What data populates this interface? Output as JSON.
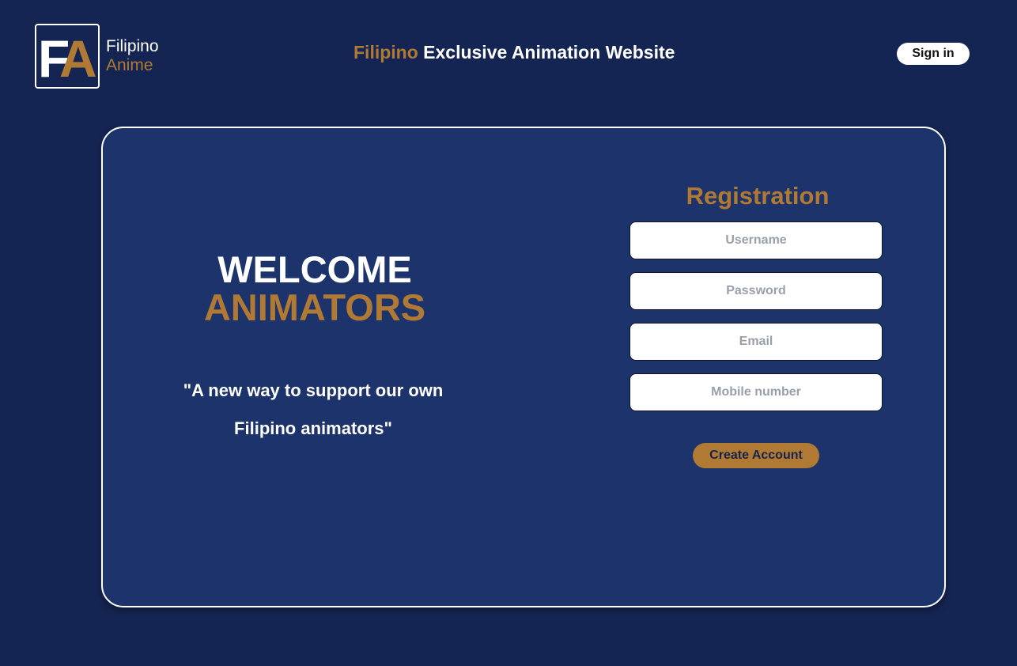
{
  "logo": {
    "letter_f": "F",
    "letter_a": "A",
    "line1": "Filipino",
    "line2": "Anime"
  },
  "header": {
    "title_accent": "Filipino",
    "title_rest": "Exclusive Animation Website",
    "signin_label": "Sign in"
  },
  "welcome": {
    "line1": "WELCOME",
    "line2": "ANIMATORS",
    "tagline": "\"A new way to support our own Filipino animators\""
  },
  "registration": {
    "title": "Registration",
    "fields": [
      {
        "placeholder": "Username",
        "value": ""
      },
      {
        "placeholder": "Password",
        "value": ""
      },
      {
        "placeholder": "Email",
        "value": ""
      },
      {
        "placeholder": "Mobile number",
        "value": ""
      }
    ],
    "submit_label": "Create Account"
  },
  "colors": {
    "background": "#152553",
    "card": "#1d336b",
    "accent": "#b07a34",
    "text": "#ffffff"
  }
}
